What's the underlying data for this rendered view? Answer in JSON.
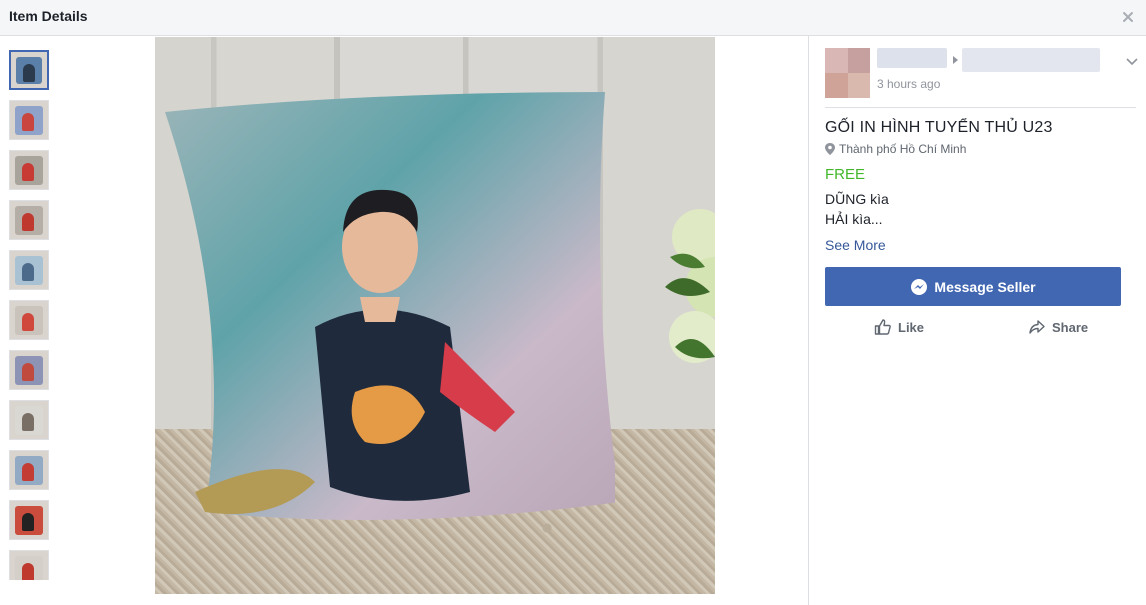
{
  "header": {
    "title": "Item Details"
  },
  "thumbnails": [
    {
      "bg": "#5a7fa8",
      "fig": "#2b3a4d"
    },
    {
      "bg": "#8fa2c9",
      "fig": "#c9453f"
    },
    {
      "bg": "#a8a39b",
      "fig": "#c73b34"
    },
    {
      "bg": "#b4aea6",
      "fig": "#c0392f"
    },
    {
      "bg": "#a9c2d3",
      "fig": "#4c6b8a"
    },
    {
      "bg": "#c9c3bb",
      "fig": "#d0473c"
    },
    {
      "bg": "#8d93b5",
      "fig": "#c04a3e"
    },
    {
      "bg": "#dad8d2",
      "fig": "#7a6f64"
    },
    {
      "bg": "#93aac4",
      "fig": "#c33d35"
    },
    {
      "bg": "#c94c3c",
      "fig": "#222222"
    },
    {
      "bg": "#d4cfc8",
      "fig": "#c0392f"
    }
  ],
  "post": {
    "timestamp": "3 hours ago"
  },
  "item": {
    "title": "GỐI IN HÌNH TUYỂN THỦ U23",
    "location": "Thành phố Hồ Chí Minh",
    "price": "FREE",
    "description_line1": "DŨNG kìa",
    "description_line2": "HẢI kìa...",
    "see_more": "See More"
  },
  "actions": {
    "message_seller": "Message Seller",
    "like": "Like",
    "share": "Share"
  },
  "colors": {
    "accent": "#4267b2",
    "price": "#42b72a",
    "link": "#365899"
  }
}
